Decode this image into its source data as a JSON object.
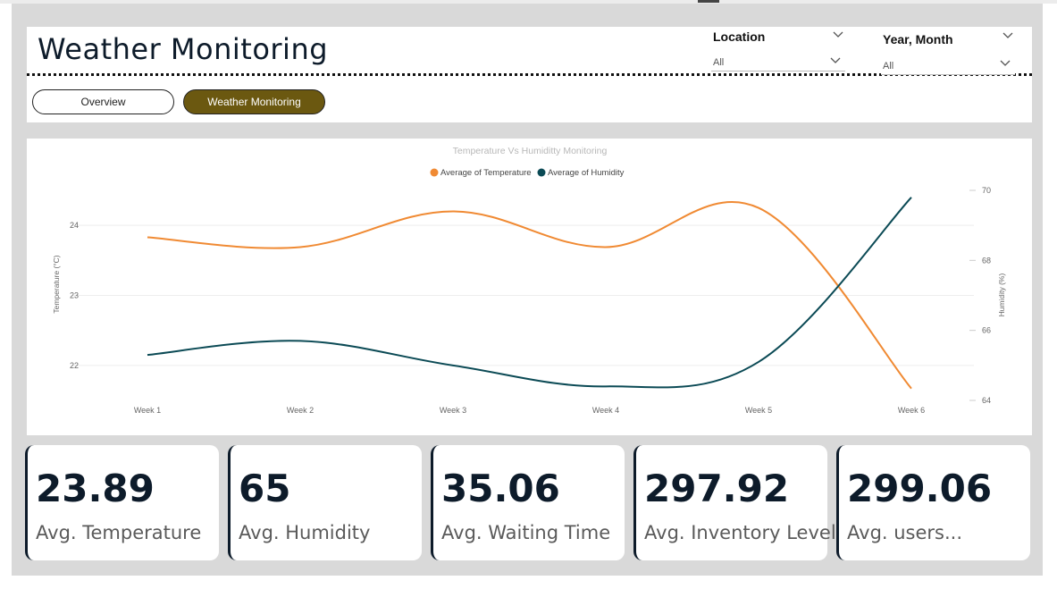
{
  "header": {
    "title": "Weather Monitoring",
    "nav": [
      "Overview",
      "Weather Monitoring"
    ],
    "active_nav": "Weather Monitoring",
    "slicers": [
      {
        "label": "Location",
        "value": "All"
      },
      {
        "label": "Year, Month",
        "value": "All"
      }
    ]
  },
  "kpis": [
    {
      "value": "23.89",
      "label": "Avg. Temperature"
    },
    {
      "value": "65",
      "label": "Avg. Humidity"
    },
    {
      "value": "35.06",
      "label": "Avg. Waiting Time"
    },
    {
      "value": "297.92",
      "label": "Avg. Inventory Level"
    },
    {
      "value": "299.06",
      "label": "Avg. users..."
    }
  ],
  "colors": {
    "temperature": "#f08a33",
    "humidity": "#0b4a55",
    "nav_active": "#6b5810",
    "kpi_text": "#0d1b2a"
  },
  "chart_data": {
    "type": "line",
    "title": "Temperature Vs Humiditty Monitoring",
    "categories": [
      "Week 1",
      "Week 2",
      "Week 3",
      "Week 4",
      "Week 5",
      "Week 6"
    ],
    "series": [
      {
        "name": "Average of Temperature",
        "axis": "left",
        "values": [
          23.83,
          23.69,
          24.2,
          23.69,
          24.25,
          21.67
        ]
      },
      {
        "name": "Average of Humidity",
        "axis": "right",
        "values": [
          65.3,
          65.7,
          65.0,
          64.4,
          65.1,
          69.8
        ]
      }
    ],
    "ylabel": "Temperature (°C)",
    "y2label": "Humidity (%)",
    "ylim": [
      21.5,
      24.5
    ],
    "y2lim": [
      64,
      70
    ],
    "yticks": [
      22,
      23,
      24
    ],
    "y2ticks": [
      64,
      66,
      68,
      70
    ],
    "legend": "top-center",
    "grid": true,
    "smooth": true
  }
}
